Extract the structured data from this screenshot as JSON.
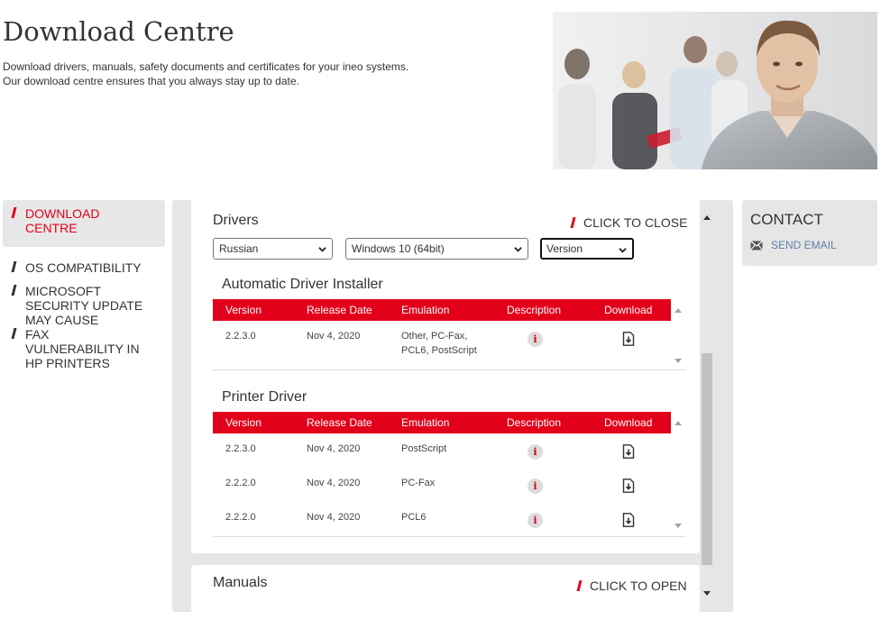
{
  "page": {
    "title": "Download Centre",
    "intro_line1": "Download drivers, manuals, safety documents and certificates for your ineo systems.",
    "intro_line2": "Our download centre ensures that you always stay up to date."
  },
  "sidebar": {
    "items": [
      {
        "lines": [
          "DOWNLOAD",
          "CENTRE"
        ],
        "active": true
      },
      {
        "lines": [
          "OS COMPATIBILITY"
        ],
        "active": false
      },
      {
        "lines": [
          "MICROSOFT",
          "SECURITY UPDATE",
          "MAY CAUSE"
        ],
        "active": false
      },
      {
        "lines": [
          "FAX",
          "VULNERABILITY IN",
          "HP PRINTERS"
        ],
        "active": false
      }
    ]
  },
  "drivers": {
    "title": "Drivers",
    "toggle": "CLICK TO CLOSE",
    "language_select": "Russian",
    "os_select": "Windows 10 (64bit)",
    "version_select": "Version",
    "columns": [
      "Version",
      "Release Date",
      "Emulation",
      "Description",
      "Download"
    ],
    "sections": [
      {
        "title": "Automatic Driver Installer",
        "rows": [
          {
            "version": "2.2.3.0",
            "date": "Nov 4, 2020",
            "emulation_lines": [
              "Other, PC-Fax,",
              "PCL6, PostScript"
            ]
          }
        ]
      },
      {
        "title": "Printer Driver",
        "rows": [
          {
            "version": "2.2.3.0",
            "date": "Nov 4, 2020",
            "emulation_lines": [
              "PostScript"
            ]
          },
          {
            "version": "2.2.2.0",
            "date": "Nov 4, 2020",
            "emulation_lines": [
              "PC-Fax"
            ]
          },
          {
            "version": "2.2.2.0",
            "date": "Nov 4, 2020",
            "emulation_lines": [
              "PCL6"
            ]
          }
        ]
      }
    ]
  },
  "manuals": {
    "title": "Manuals",
    "toggle": "CLICK TO OPEN"
  },
  "contact": {
    "title": "CONTACT",
    "email_link": "SEND EMAIL"
  },
  "colors": {
    "accent": "#e2001a",
    "panel_bg": "#e6e6e6",
    "link": "#5a7ea8"
  },
  "icons": {
    "info": "info-icon",
    "download": "download-file-icon",
    "email": "envelope-icon"
  }
}
